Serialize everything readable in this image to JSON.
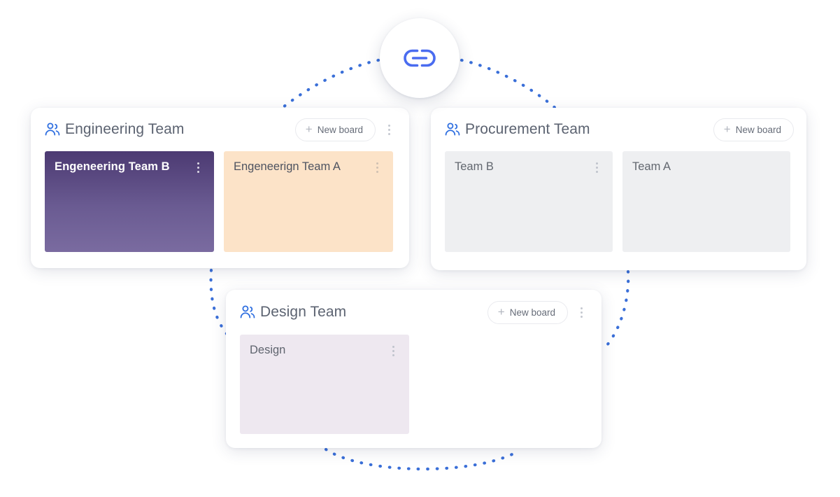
{
  "link_badge": {
    "icon": "link-chain-icon",
    "color": "#4a6cf0"
  },
  "accent": {
    "team_icon_color": "#2f6fe0",
    "connector_dot_color": "#3a6fd8"
  },
  "teams": [
    {
      "id": "engineering",
      "icon": "users-icon",
      "title": "Engineering Team",
      "new_board_label": "New board",
      "new_board_plus": "+",
      "has_header_menu": true,
      "boards": [
        {
          "id": "eng-b",
          "title": "Engeneering Team B",
          "color": "#6a5b92",
          "has_menu": true
        },
        {
          "id": "eng-a",
          "title": "Engeneerign Team A",
          "color": "#fce3c8",
          "has_menu": true
        }
      ]
    },
    {
      "id": "procurement",
      "icon": "users-icon",
      "title": "Procurement Team",
      "new_board_label": "New board",
      "new_board_plus": "+",
      "has_header_menu": false,
      "boards": [
        {
          "id": "proc-b",
          "title": "Team B",
          "color": "#eeeff1",
          "has_menu": true
        },
        {
          "id": "proc-a",
          "title": "Team A",
          "color": "#eeeff1",
          "has_menu": false
        }
      ]
    },
    {
      "id": "design",
      "icon": "users-icon",
      "title": "Design Team",
      "new_board_label": "New board",
      "new_board_plus": "+",
      "has_header_menu": true,
      "boards": [
        {
          "id": "design-1",
          "title": "Design",
          "color": "#eee8f0",
          "has_menu": true
        }
      ]
    }
  ]
}
